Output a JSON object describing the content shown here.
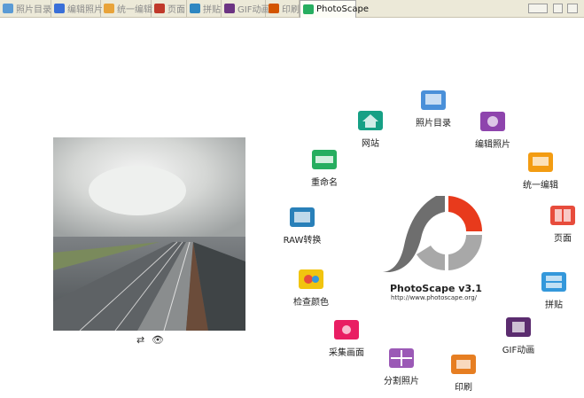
{
  "tabs": [
    {
      "label": "照片目录",
      "color": "#5b9bd5"
    },
    {
      "label": "编辑照片",
      "color": "#3a6fd8"
    },
    {
      "label": "统一编辑",
      "color": "#e8a33a"
    },
    {
      "label": "页面",
      "color": "#c0392b"
    },
    {
      "label": "拼贴",
      "color": "#2e86c1"
    },
    {
      "label": "GIF动画",
      "color": "#6c3483"
    },
    {
      "label": "印刷",
      "color": "#d35400"
    },
    {
      "label": "PhotoScape",
      "color": "#27ae60"
    }
  ],
  "menu": [
    {
      "label": "照片目录",
      "color": "#4a90d9"
    },
    {
      "label": "编辑照片",
      "color": "#8e44ad"
    },
    {
      "label": "统一编辑",
      "color": "#f39c12"
    },
    {
      "label": "页面",
      "color": "#e74c3c"
    },
    {
      "label": "拼贴",
      "color": "#3498db"
    },
    {
      "label": "GIF动画",
      "color": "#5b2c6f"
    },
    {
      "label": "印刷",
      "color": "#e67e22"
    },
    {
      "label": "分割照片",
      "color": "#9b59b6"
    },
    {
      "label": "采集画面",
      "color": "#e91e63"
    },
    {
      "label": "检查颜色",
      "color": "#f1c40f"
    },
    {
      "label": "RAW转换",
      "color": "#2980b9"
    },
    {
      "label": "重命名",
      "color": "#27ae60"
    },
    {
      "label": "网站",
      "color": "#16a085"
    }
  ],
  "brand": {
    "name": "PhotoScape v3.1",
    "url": "http://www.photoscape.org/"
  },
  "controls": {
    "refresh": "⇄",
    "view": "👁"
  },
  "colors": {
    "logo_gray": "#6e6e6e",
    "logo_red": "#e83a1c",
    "logo_light": "#a8a8a8"
  }
}
